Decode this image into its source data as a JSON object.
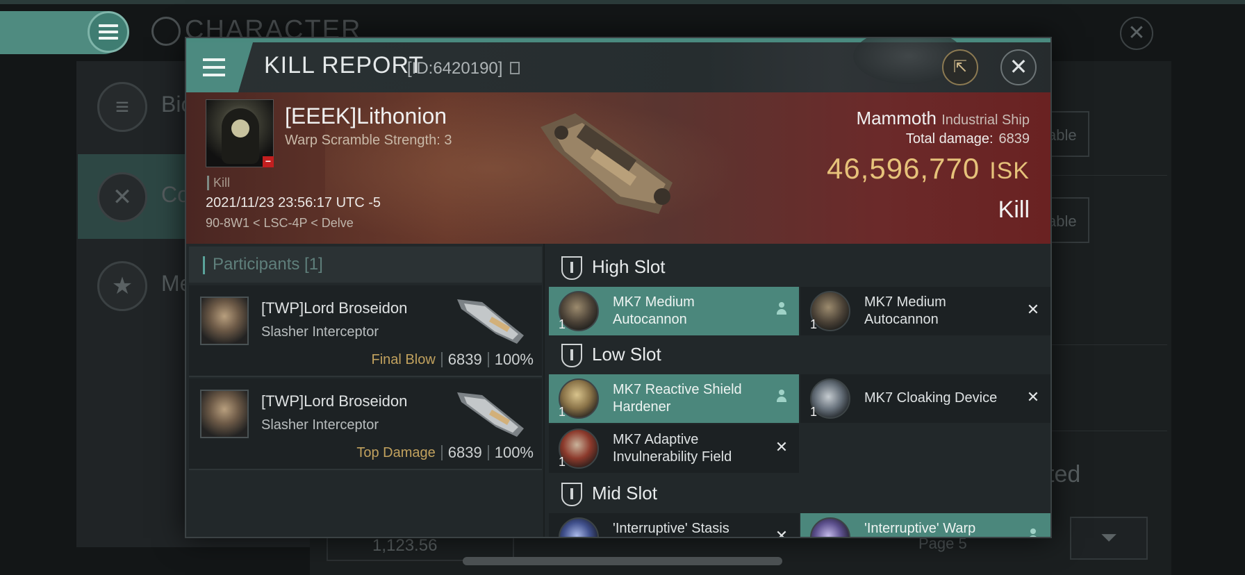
{
  "background": {
    "title": "CHARACTER",
    "side_items": [
      {
        "label": "Bio"
      },
      {
        "label": "Co"
      },
      {
        "label": "Me"
      }
    ],
    "right_buttons": [
      "able",
      "able"
    ],
    "partial_text": "ted",
    "bottom_value": "1,123.56",
    "page_label": "Page 5"
  },
  "modal": {
    "title": "KILL REPORT",
    "id_text": "[ID:6420190]",
    "victim": {
      "name": "[EEEK]Lithonion",
      "subtitle": "Warp Scramble Strength: 3",
      "tag": "Kill",
      "datetime": "2021/11/23 23:56:17 UTC -5",
      "location": "90-8W1 < LSC-4P < Delve"
    },
    "ship": {
      "name": "Mammoth",
      "class": "Industrial Ship",
      "total_damage_label": "Total damage:",
      "total_damage": "6839",
      "isk_value": "46,596,770",
      "isk_unit": "ISK",
      "result": "Kill"
    },
    "participants": {
      "header": "Participants [1]",
      "rows": [
        {
          "name": "[TWP]Lord Broseidon",
          "ship": "Slasher Interceptor",
          "label": "Final Blow",
          "damage": "6839",
          "percent": "100%"
        },
        {
          "name": "[TWP]Lord Broseidon",
          "ship": "Slasher Interceptor",
          "label": "Top Damage",
          "damage": "6839",
          "percent": "100%"
        }
      ]
    },
    "slots": {
      "high": {
        "label": "High Slot",
        "modules": [
          {
            "name": "MK7 Medium Autocannon",
            "qty": "1",
            "state": "dropped"
          },
          {
            "name": "MK7 Medium Autocannon",
            "qty": "1",
            "state": "destroyed"
          }
        ]
      },
      "low": {
        "label": "Low Slot",
        "modules": [
          {
            "name": "MK7 Reactive Shield Hardener",
            "qty": "1",
            "state": "dropped"
          },
          {
            "name": "MK7 Cloaking Device",
            "qty": "1",
            "state": "destroyed"
          },
          {
            "name": "MK7 Adaptive Invulnerability Field",
            "qty": "1",
            "state": "destroyed"
          }
        ]
      },
      "mid": {
        "label": "Mid Slot",
        "modules": [
          {
            "name": "'Interruptive' Stasis",
            "qty": "1",
            "state": "destroyed"
          },
          {
            "name": "'Interruptive' Warp",
            "qty": "1",
            "state": "dropped"
          }
        ]
      }
    },
    "icons": {
      "destroyed": "close-icon",
      "dropped": "person-icon"
    },
    "colors": {
      "accent": "#4b877c",
      "isk": "#e6c27a",
      "label_gold": "#c2a25e",
      "kill_red": "#c21f1f"
    }
  }
}
